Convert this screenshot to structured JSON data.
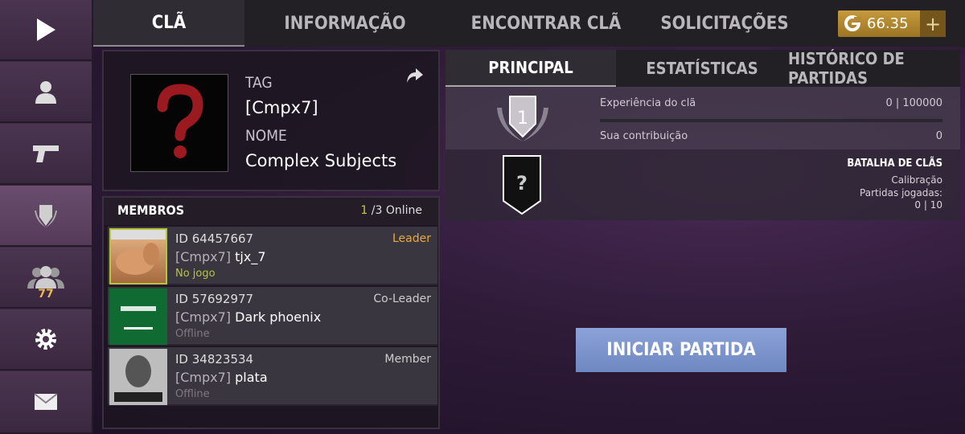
{
  "sidebar": {
    "items": [
      {
        "icon": "play-icon"
      },
      {
        "icon": "profile-icon"
      },
      {
        "icon": "pistol-icon"
      },
      {
        "icon": "clan-emblem-icon"
      },
      {
        "icon": "friends-icon",
        "count": "77"
      },
      {
        "icon": "gear-icon"
      },
      {
        "icon": "mail-icon"
      }
    ]
  },
  "tabs": [
    "CLÃ",
    "INFORMAÇÃO",
    "ENCONTRAR CLÃ",
    "SOLICITAÇÕES"
  ],
  "currency": {
    "value": "66.35",
    "plus": "+",
    "icon": "gold-g-icon"
  },
  "clan": {
    "tag_label": "TAG",
    "tag": "[Cmpx7]",
    "name_label": "NOME",
    "name": "Complex Subjects"
  },
  "members": {
    "title": "MEMBROS",
    "online_count": "1",
    "online_rest": "/3 Online",
    "list": [
      {
        "id": "ID 64457667",
        "role": "Leader",
        "tag": "[Cmpx7]",
        "name": "tjx_7",
        "status": "No jogo"
      },
      {
        "id": "ID 57692977",
        "role": "Co-Leader",
        "tag": "[Cmpx7]",
        "name": "Dark phoenix",
        "status": "Offline"
      },
      {
        "id": "ID 34823534",
        "role": "Member",
        "tag": "[Cmpx7]",
        "name": "plata",
        "status": "Offline"
      }
    ]
  },
  "right_tabs": [
    "PRINCIPAL",
    "ESTATÍSTICAS",
    "HISTÓRICO DE PARTIDAS"
  ],
  "stats": {
    "level": "1",
    "xp_label": "Experiência do clã",
    "xp_value": "0 | 100000",
    "xp_progress": 0,
    "contribution_label": "Sua contribuição",
    "contribution_value": "0"
  },
  "battle": {
    "rank_symbol": "?",
    "title": "BATALHA DE CLÃS",
    "calibration": "Calibração",
    "matches_label": "Partidas jogadas:",
    "matches_value": "0 | 10"
  },
  "start_button": "INICIAR PARTIDA",
  "colors": {
    "gold": "#c69a3c",
    "button": "#7d96cc",
    "ingame": "#b8c43a",
    "leader": "#e6a940"
  }
}
